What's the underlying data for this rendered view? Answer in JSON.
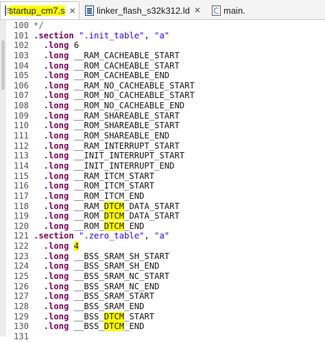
{
  "tabs": [
    {
      "label": "startup_cm7.s",
      "icon": "asm-file-icon",
      "active": true,
      "highlighted": true,
      "close": "✕"
    },
    {
      "label": "linker_flash_s32k312.ld",
      "icon": "linker-file-icon",
      "active": false,
      "highlighted": false,
      "close": "✕"
    },
    {
      "label": "main.",
      "icon": "c-file-icon",
      "active": false,
      "highlighted": false,
      "close": ""
    }
  ],
  "highlight_color": "#ffff00",
  "lines": [
    {
      "num": "100",
      "parts": [
        {
          "t": "*/",
          "c": "cm"
        }
      ]
    },
    {
      "num": "101",
      "parts": [
        {
          "t": ".section",
          "c": "kw"
        },
        {
          "t": " ",
          "c": ""
        },
        {
          "t": "\".init_table\"",
          "c": "str"
        },
        {
          "t": ", ",
          "c": ""
        },
        {
          "t": "\"a\"",
          "c": "str"
        }
      ]
    },
    {
      "num": "102",
      "parts": [
        {
          "t": "  .long",
          "c": "kw"
        },
        {
          "t": " 6",
          "c": ""
        }
      ]
    },
    {
      "num": "103",
      "parts": [
        {
          "t": "  .long",
          "c": "kw"
        },
        {
          "t": " __RAM_CACHEABLE_START",
          "c": ""
        }
      ]
    },
    {
      "num": "104",
      "parts": [
        {
          "t": "  .long",
          "c": "kw"
        },
        {
          "t": " __ROM_CACHEABLE_START",
          "c": ""
        }
      ]
    },
    {
      "num": "105",
      "parts": [
        {
          "t": "  .long",
          "c": "kw"
        },
        {
          "t": " __ROM_CACHEABLE_END",
          "c": ""
        }
      ]
    },
    {
      "num": "106",
      "parts": [
        {
          "t": "  .long",
          "c": "kw"
        },
        {
          "t": " __RAM_NO_CACHEABLE_START",
          "c": ""
        }
      ]
    },
    {
      "num": "107",
      "parts": [
        {
          "t": "  .long",
          "c": "kw"
        },
        {
          "t": " __ROM_NO_CACHEABLE_START",
          "c": ""
        }
      ]
    },
    {
      "num": "108",
      "parts": [
        {
          "t": "  .long",
          "c": "kw"
        },
        {
          "t": " __ROM_NO_CACHEABLE_END",
          "c": ""
        }
      ]
    },
    {
      "num": "109",
      "parts": [
        {
          "t": "  .long",
          "c": "kw"
        },
        {
          "t": " __RAM_SHAREABLE_START",
          "c": ""
        }
      ]
    },
    {
      "num": "110",
      "parts": [
        {
          "t": "  .long",
          "c": "kw"
        },
        {
          "t": " __ROM_SHAREABLE_START",
          "c": ""
        }
      ]
    },
    {
      "num": "111",
      "parts": [
        {
          "t": "  .long",
          "c": "kw"
        },
        {
          "t": " __ROM_SHAREABLE_END",
          "c": ""
        }
      ]
    },
    {
      "num": "112",
      "parts": [
        {
          "t": "  .long",
          "c": "kw"
        },
        {
          "t": " __RAM_INTERRUPT_START",
          "c": ""
        }
      ]
    },
    {
      "num": "113",
      "parts": [
        {
          "t": "  .long",
          "c": "kw"
        },
        {
          "t": " __INIT_INTERRUPT_START",
          "c": ""
        }
      ]
    },
    {
      "num": "114",
      "parts": [
        {
          "t": "  .long",
          "c": "kw"
        },
        {
          "t": " __INIT_INTERRUPT_END",
          "c": ""
        }
      ]
    },
    {
      "num": "115",
      "parts": [
        {
          "t": "  .long",
          "c": "kw"
        },
        {
          "t": " __RAM_ITCM_START",
          "c": ""
        }
      ]
    },
    {
      "num": "116",
      "parts": [
        {
          "t": "  .long",
          "c": "kw"
        },
        {
          "t": " __ROM_ITCM_START",
          "c": ""
        }
      ]
    },
    {
      "num": "117",
      "parts": [
        {
          "t": "  .long",
          "c": "kw"
        },
        {
          "t": " __ROM_ITCM_END",
          "c": ""
        }
      ]
    },
    {
      "num": "118",
      "parts": [
        {
          "t": "  .long",
          "c": "kw"
        },
        {
          "t": " __RAM_",
          "c": ""
        },
        {
          "t": "DTCM",
          "c": "hl"
        },
        {
          "t": "_DATA_START",
          "c": ""
        }
      ]
    },
    {
      "num": "119",
      "parts": [
        {
          "t": "  .long",
          "c": "kw"
        },
        {
          "t": " __ROM_",
          "c": ""
        },
        {
          "t": "DTCM",
          "c": "hl"
        },
        {
          "t": "_DATA_START",
          "c": ""
        }
      ]
    },
    {
      "num": "120",
      "parts": [
        {
          "t": "  .long",
          "c": "kw"
        },
        {
          "t": " __ROM_",
          "c": ""
        },
        {
          "t": "DTCM",
          "c": "hl"
        },
        {
          "t": "_END",
          "c": ""
        }
      ]
    },
    {
      "num": "121",
      "parts": [
        {
          "t": ".section",
          "c": "kw"
        },
        {
          "t": " ",
          "c": ""
        },
        {
          "t": "\".zero_table\"",
          "c": "str"
        },
        {
          "t": ", ",
          "c": ""
        },
        {
          "t": "\"a\"",
          "c": "str"
        }
      ]
    },
    {
      "num": "122",
      "parts": [
        {
          "t": "  .long",
          "c": "kw"
        },
        {
          "t": " ",
          "c": ""
        },
        {
          "t": "4",
          "c": "hl"
        }
      ]
    },
    {
      "num": "123",
      "parts": [
        {
          "t": "  .long",
          "c": "kw"
        },
        {
          "t": " __BSS_SRAM_SH_START",
          "c": ""
        }
      ]
    },
    {
      "num": "124",
      "parts": [
        {
          "t": "  .long",
          "c": "kw"
        },
        {
          "t": " __BSS_SRAM_SH_END",
          "c": ""
        }
      ]
    },
    {
      "num": "125",
      "parts": [
        {
          "t": "  .long",
          "c": "kw"
        },
        {
          "t": " __BSS_SRAM_NC_START",
          "c": ""
        }
      ]
    },
    {
      "num": "126",
      "parts": [
        {
          "t": "  .long",
          "c": "kw"
        },
        {
          "t": " __BSS_SRAM_NC_END",
          "c": ""
        }
      ]
    },
    {
      "num": "127",
      "parts": [
        {
          "t": "  .long",
          "c": "kw"
        },
        {
          "t": " __BSS_SRAM_START",
          "c": ""
        }
      ]
    },
    {
      "num": "128",
      "parts": [
        {
          "t": "  .long",
          "c": "kw"
        },
        {
          "t": " __BSS_SRAM_END",
          "c": ""
        }
      ]
    },
    {
      "num": "129",
      "parts": [
        {
          "t": "  .long",
          "c": "kw"
        },
        {
          "t": " __BSS_",
          "c": ""
        },
        {
          "t": "DTCM",
          "c": "hl"
        },
        {
          "t": "_START",
          "c": ""
        }
      ]
    },
    {
      "num": "130",
      "parts": [
        {
          "t": "  .long",
          "c": "kw"
        },
        {
          "t": " __BSS_",
          "c": ""
        },
        {
          "t": "DTCM",
          "c": "hl"
        },
        {
          "t": "_END",
          "c": ""
        }
      ]
    },
    {
      "num": "131",
      "parts": []
    }
  ]
}
